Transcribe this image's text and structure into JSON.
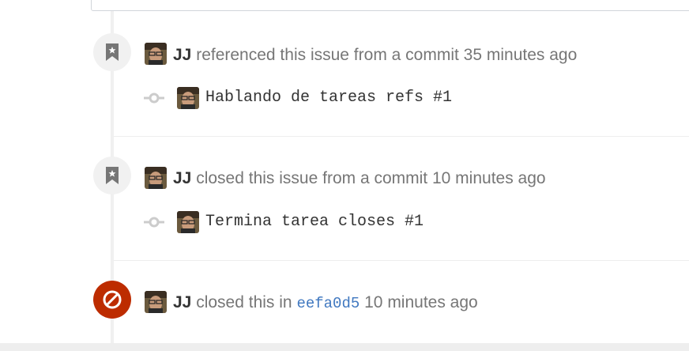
{
  "events": [
    {
      "author": "JJ",
      "action": "referenced this issue from a commit",
      "time": "35 minutes ago",
      "commit_message": "Hablando de tareas refs #1"
    },
    {
      "author": "JJ",
      "action": "closed this issue from a commit",
      "time": "10 minutes ago",
      "commit_message": "Termina tarea closes #1"
    },
    {
      "author": "JJ",
      "action": "closed this in",
      "sha": "eefa0d5",
      "time": "10 minutes ago"
    }
  ],
  "colors": {
    "closed_badge": "#bd2c00",
    "link": "#4078c0",
    "text_muted": "#767676",
    "text_strong": "#333333"
  },
  "icons": [
    "bookmark-icon",
    "git-commit-icon",
    "circle-slash-icon"
  ]
}
